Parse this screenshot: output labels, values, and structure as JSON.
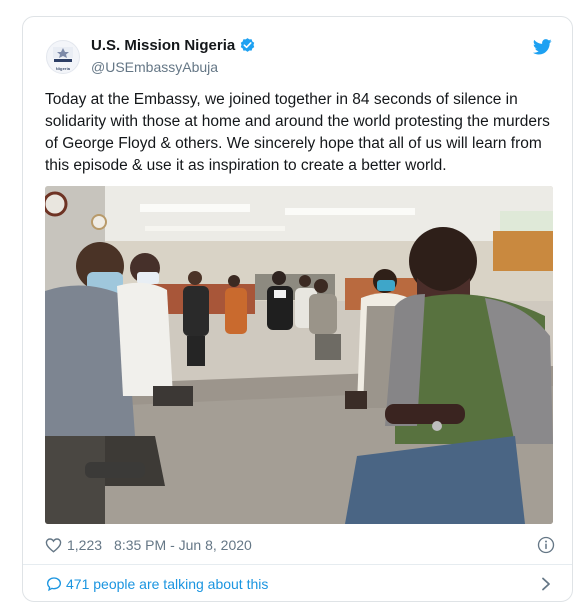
{
  "tweet": {
    "author": {
      "display_name": "U.S. Mission Nigeria",
      "handle": "@USEmbassyAbuja",
      "verified": true,
      "avatar_icon": "us-embassy-seal-icon",
      "avatar_text": [
        "US MISSION",
        "Nigeria"
      ]
    },
    "platform_icon": "twitter-bird-icon",
    "text": "Today at the Embassy, we joined together in 84 seconds of silence in solidarity with those at home and around the world protesting the murders of George Floyd & others. We sincerely hope that all of us will learn from this episode & use it as inspiration to create a better world.",
    "likes": "1,223",
    "timestamp": "8:35 PM - Jun 8, 2020",
    "conversation_text": "471 people are talking about this"
  },
  "colors": {
    "link_blue": "#1b95e0",
    "verified_blue": "#1da1f2",
    "muted_gray": "#657786",
    "text": "#14171a",
    "border": "#dfe3e6"
  }
}
